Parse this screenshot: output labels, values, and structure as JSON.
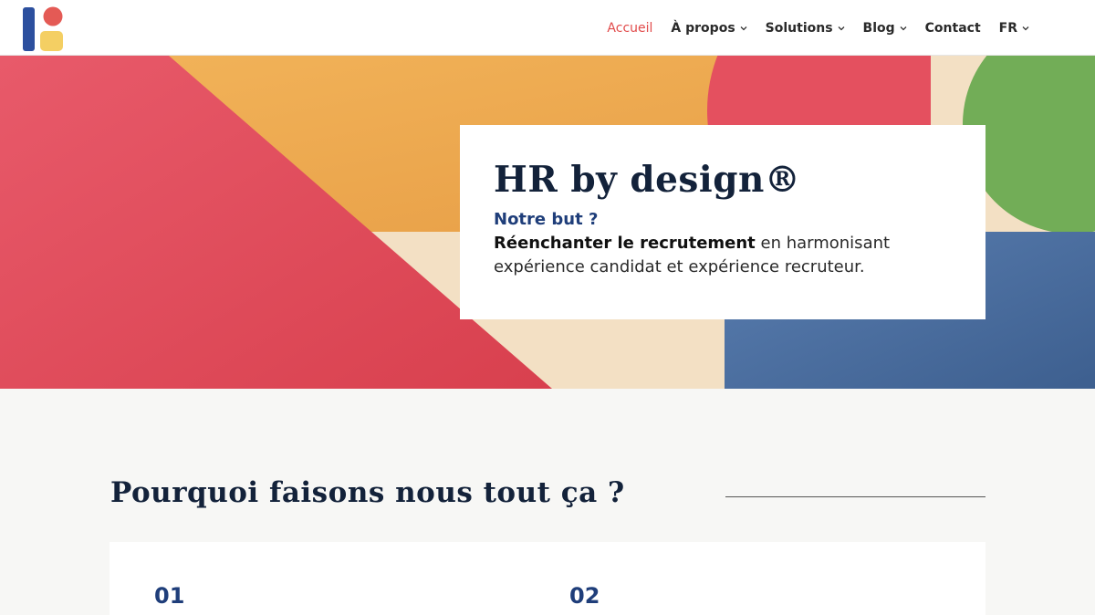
{
  "header": {
    "logo_icon": "brand-logo-icon",
    "nav": [
      {
        "label": "Accueil",
        "active": true,
        "has_dropdown": false
      },
      {
        "label": "À propos",
        "active": false,
        "has_dropdown": true
      },
      {
        "label": "Solutions",
        "active": false,
        "has_dropdown": true
      },
      {
        "label": "Blog",
        "active": false,
        "has_dropdown": true
      },
      {
        "label": "Contact",
        "active": false,
        "has_dropdown": false
      },
      {
        "label": "FR",
        "active": false,
        "has_dropdown": true
      }
    ]
  },
  "hero": {
    "title": "HR by design®",
    "subtitle": "Notre but ?",
    "text_bold": "Réenchanter le recrutement",
    "text_rest": " en harmonisant expérience candidat et expérience recruteur."
  },
  "section": {
    "title": "Pourquoi faisons nous tout ça ?",
    "cards": [
      {
        "number": "01"
      },
      {
        "number": "02"
      }
    ]
  },
  "colors": {
    "accent": "#e14b4b",
    "navy": "#13223a",
    "blue": "#1f3e7a",
    "red": "#e0485a",
    "orange": "#efae4f",
    "cream": "#f3e0c4",
    "green": "#72ad57",
    "steel_blue": "#4c70a0"
  }
}
